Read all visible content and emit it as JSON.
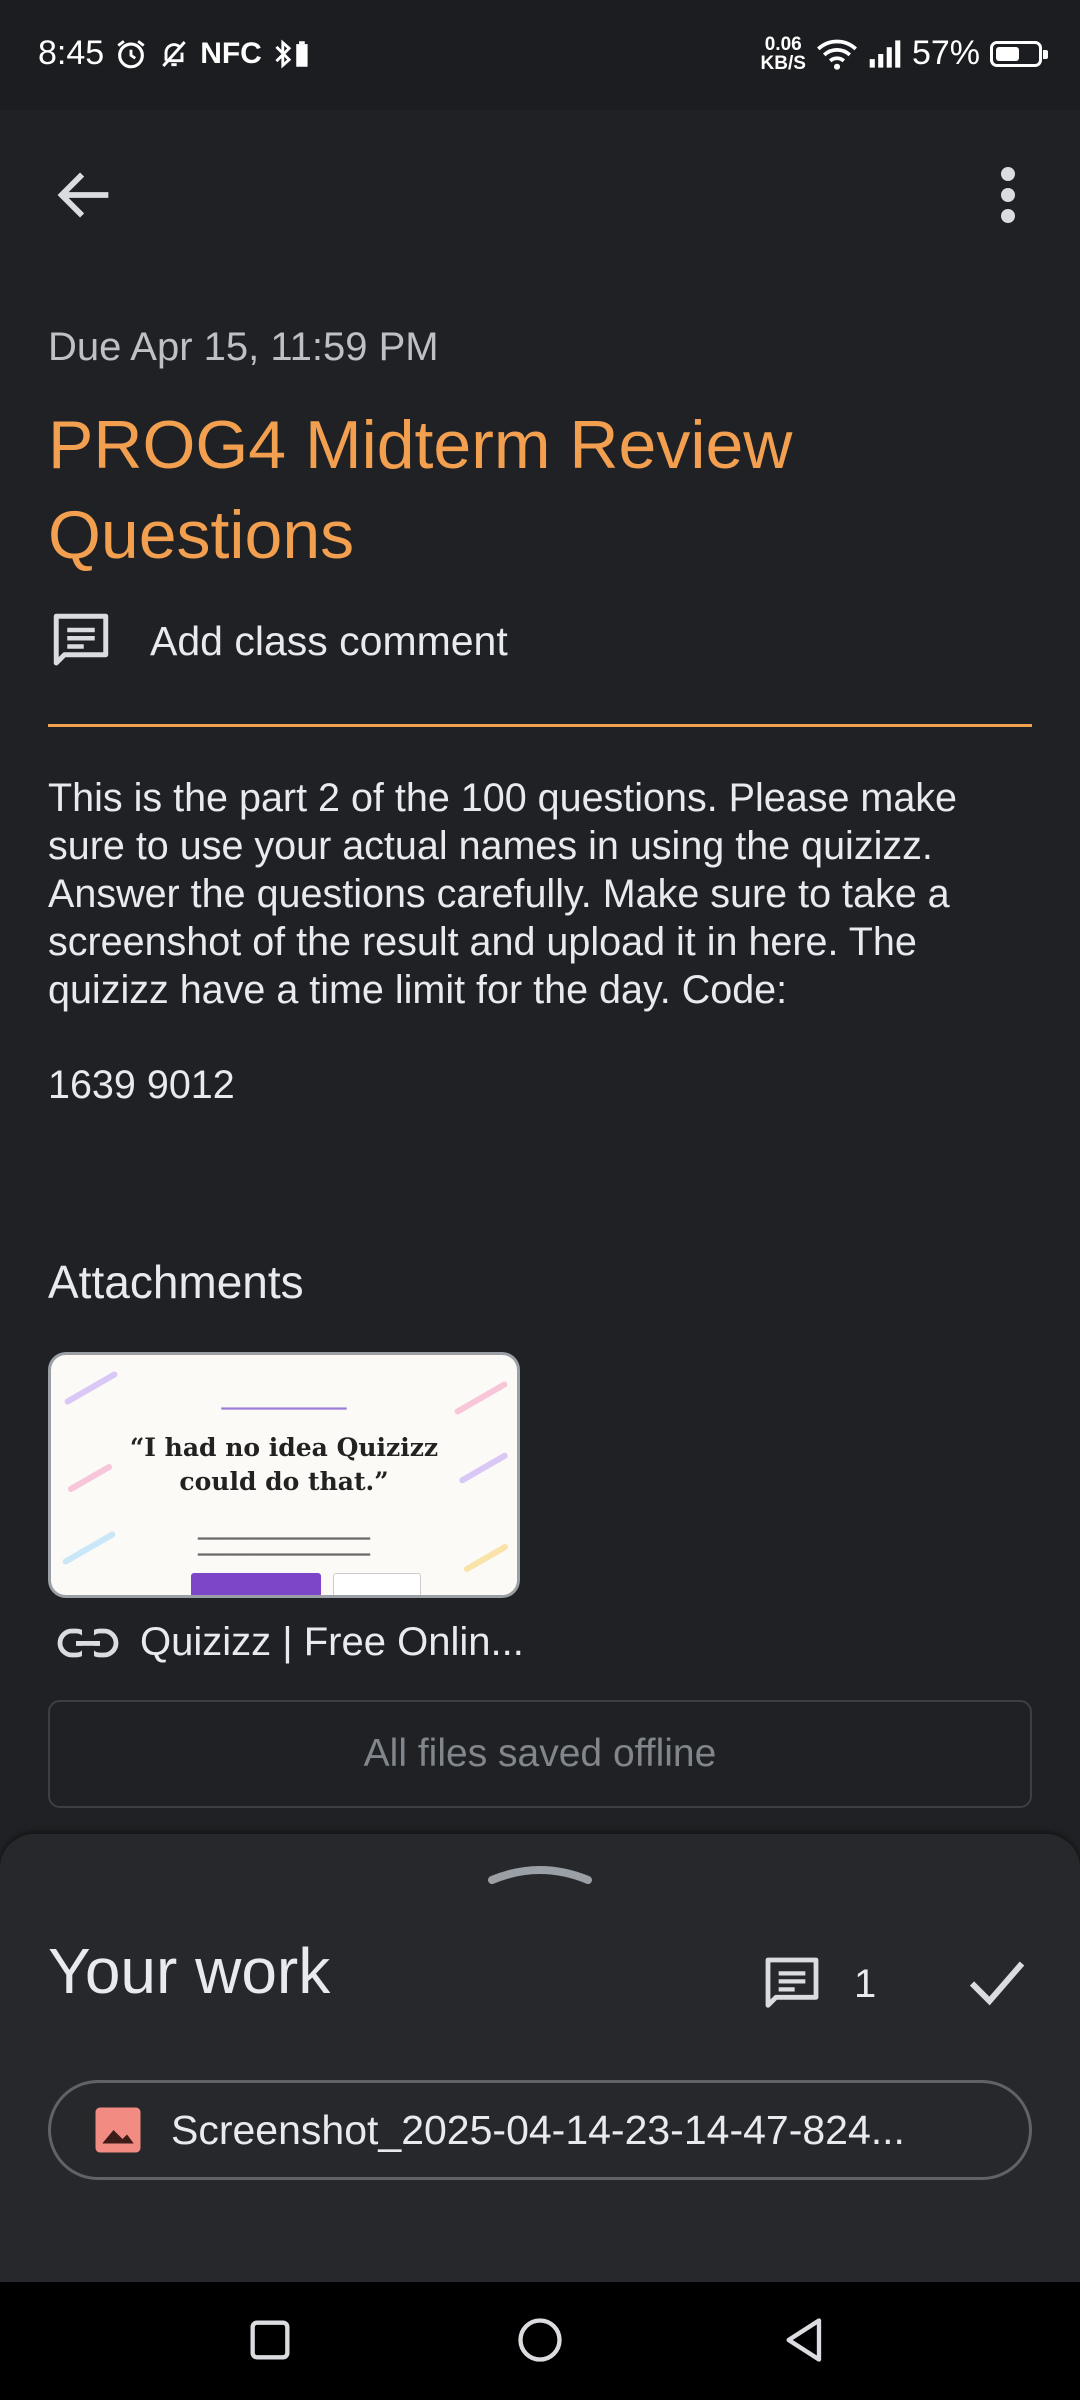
{
  "status_bar": {
    "time": "8:45",
    "nfc": "NFC",
    "net_speed_value": "0.06",
    "net_speed_unit": "KB/S",
    "battery_percent_label": "57%",
    "battery_level": 0.57
  },
  "assignment": {
    "due": "Due Apr 15, 11:59 PM",
    "title": "PROG4 Midterm Review Questions",
    "add_comment_label": "Add class comment",
    "description": "This is the part 2 of the 100 questions. Please make sure to use your actual names in using the quizizz. Answer the questions carefully. Make sure to take a screenshot of the result and upload it in here. The quizizz have a time limit for the day. Code:",
    "code": "1639 9012"
  },
  "attachments": {
    "heading": "Attachments",
    "items": [
      {
        "link_label": "Quizizz | Free Onlin...",
        "thumb_quote_line1": "“I had no idea Quizizz",
        "thumb_quote_line2": "could do that.”"
      }
    ],
    "offline_label": "All files saved offline"
  },
  "your_work": {
    "title": "Your work",
    "comment_count": "1",
    "file_name": "Screenshot_2025-04-14-23-14-47-824..."
  },
  "icons": {
    "back": "arrow-back-icon",
    "more": "more-vert-icon",
    "comment": "comment-icon",
    "link": "link-icon",
    "image": "image-icon",
    "check": "check-icon"
  },
  "colors": {
    "accent": "#f29f4f",
    "background": "#202124",
    "sheet": "#27282b",
    "image_icon": "#f28b82"
  }
}
